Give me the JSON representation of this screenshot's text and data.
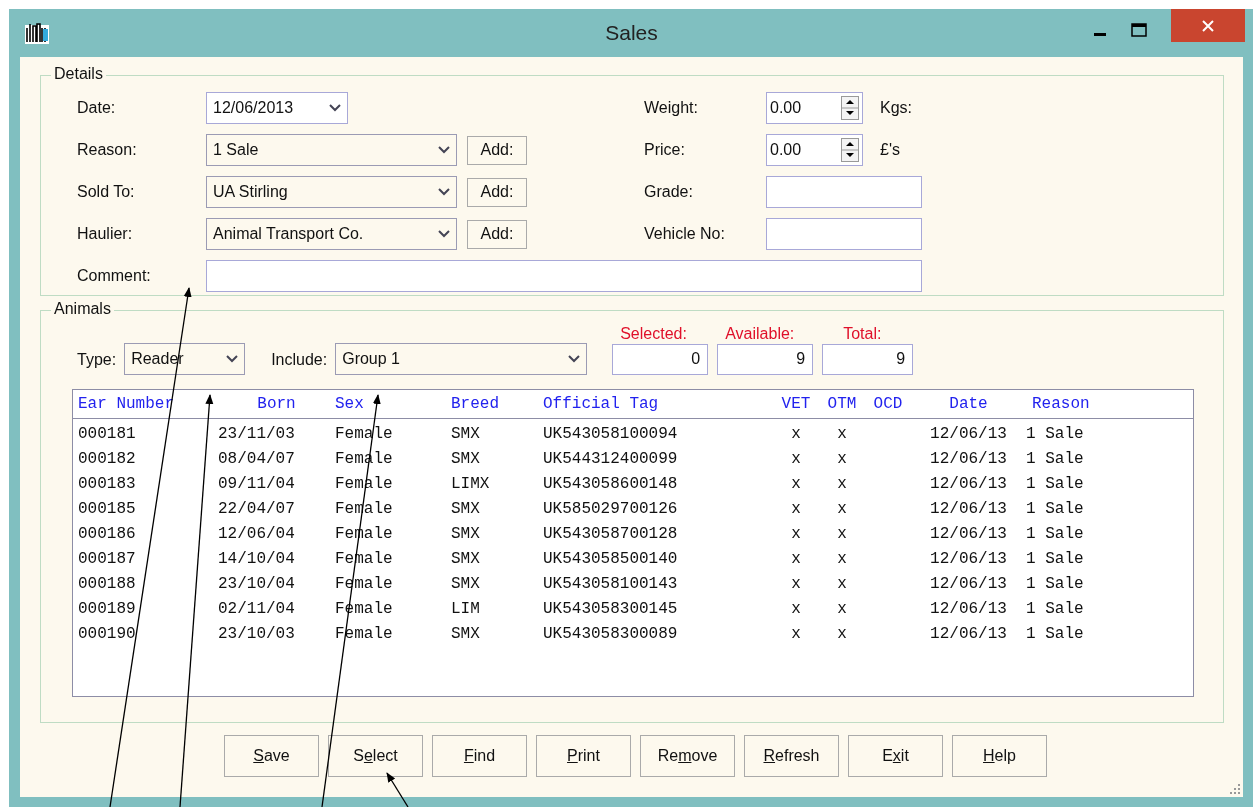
{
  "window": {
    "title": "Sales"
  },
  "details": {
    "legend": "Details",
    "left_fields": [
      {
        "label": "Date:",
        "kind": "date",
        "value": "12/06/2013"
      },
      {
        "label": "Reason:",
        "kind": "combo",
        "value": "1 Sale",
        "add_button": "Add:"
      },
      {
        "label": "Sold To:",
        "kind": "combo",
        "value": "UA Stirling",
        "add_button": "Add:"
      },
      {
        "label": "Haulier:",
        "kind": "combo",
        "value": "Animal Transport Co.",
        "add_button": "Add:"
      }
    ],
    "right_fields": [
      {
        "label": "Weight:",
        "kind": "spinner",
        "value": "0.00",
        "unit": "Kgs:"
      },
      {
        "label": "Price:",
        "kind": "spinner",
        "value": "0.00",
        "unit": "£'s"
      },
      {
        "label": "Grade:",
        "kind": "text"
      },
      {
        "label": "Vehicle No:",
        "kind": "text"
      }
    ],
    "comment": {
      "label": "Comment:"
    }
  },
  "animals": {
    "legend": "Animals",
    "type": {
      "label": "Type:",
      "value": "Reader"
    },
    "include": {
      "label": "Include:",
      "value": "Group 1"
    },
    "counters": [
      {
        "label": "Selected:",
        "value": "0"
      },
      {
        "label": "Available:",
        "value": "9"
      },
      {
        "label": "Total:",
        "value": "9"
      }
    ],
    "table": {
      "columns": [
        "Ear Number",
        "Born",
        "Sex",
        "Breed",
        "Official Tag",
        "VET",
        "OTM",
        "OCD",
        "Date",
        "Reason"
      ],
      "rows": [
        [
          "000181",
          "23/11/03",
          "Female",
          "SMX",
          "UK543058100094",
          "x",
          "x",
          null,
          "12/06/13",
          "1 Sale"
        ],
        [
          "000182",
          "08/04/07",
          "Female",
          "SMX",
          "UK544312400099",
          "x",
          "x",
          null,
          "12/06/13",
          "1 Sale"
        ],
        [
          "000183",
          "09/11/04",
          "Female",
          "LIMX",
          "UK543058600148",
          "x",
          "x",
          null,
          "12/06/13",
          "1 Sale"
        ],
        [
          "000185",
          "22/04/07",
          "Female",
          "SMX",
          "UK585029700126",
          "x",
          "x",
          null,
          "12/06/13",
          "1 Sale"
        ],
        [
          "000186",
          "12/06/04",
          "Female",
          "SMX",
          "UK543058700128",
          "x",
          "x",
          null,
          "12/06/13",
          "1 Sale"
        ],
        [
          "000187",
          "14/10/04",
          "Female",
          "SMX",
          "UK543058500140",
          "x",
          "x",
          null,
          "12/06/13",
          "1 Sale"
        ],
        [
          "000188",
          "23/10/04",
          "Female",
          "SMX",
          "UK543058100143",
          "x",
          "x",
          null,
          "12/06/13",
          "1 Sale"
        ],
        [
          "000189",
          "02/11/04",
          "Female",
          "LIM",
          "UK543058300145",
          "x",
          "x",
          null,
          "12/06/13",
          "1 Sale"
        ],
        [
          "000190",
          "23/10/03",
          "Female",
          "SMX",
          "UK543058300089",
          "x",
          "x",
          null,
          "12/06/13",
          "1 Sale"
        ]
      ]
    }
  },
  "buttons": [
    {
      "key": "S",
      "after": "ave"
    },
    {
      "before": "S",
      "key": "e",
      "after": "lect"
    },
    {
      "key": "F",
      "after": "ind"
    },
    {
      "key": "P",
      "after": "rint"
    },
    {
      "before": "Re",
      "key": "m",
      "after": "ove"
    },
    {
      "key": "R",
      "after": "efresh"
    },
    {
      "before": "E",
      "key": "x",
      "after": "it"
    },
    {
      "key": "H",
      "after": "elp"
    }
  ]
}
